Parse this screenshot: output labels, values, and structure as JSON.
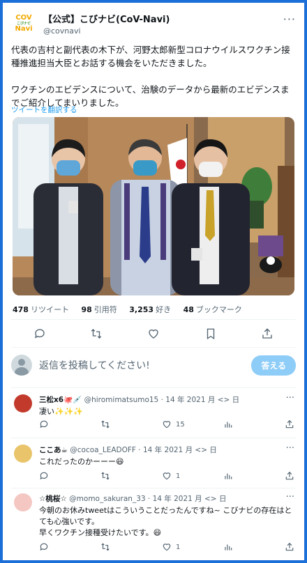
{
  "tweet": {
    "display_name": "【公式】こびナビ(CoV-Navi)",
    "handle": "@covnavi",
    "logo_text": [
      "COV",
      "こびナビ",
      "Navi"
    ],
    "text": "代表の吉村と副代表の木下が、河野太郎新型コロナウイルスワクチン接種推進担当大臣とお話する機会をいただきました。\n\nワクチンのエビデンスについて、治験のデータから最新のエビデンスまでご紹介してまいりました。",
    "translate_label": "ツイートを翻訳する",
    "stats": {
      "retweets": "478",
      "retweets_label": "リツイート",
      "quotes": "98",
      "quotes_label": "引用符",
      "likes": "3,253",
      "likes_label": "好き",
      "bookmarks": "48",
      "bookmarks_label": "ブックマーク"
    }
  },
  "reply_box": {
    "placeholder": "返信を投稿してください!",
    "button": "答える"
  },
  "replies": [
    {
      "name": "三松x6",
      "emoji": "🐙💉",
      "handle": "@hiromimatsumo15",
      "date": "· 14 年 2021 月 <> 日",
      "text": "凄い✨✨✨",
      "reply_count": "",
      "retweet_count": "",
      "like_count": "15",
      "avatar_color": "#c23a2b"
    },
    {
      "name": "ここあ☕",
      "emoji": "",
      "handle": "@cocoa_LEADOFF",
      "date": "· 14 年 2021 月 <> 日",
      "text": "これだったのかーーー😄",
      "reply_count": "",
      "retweet_count": "",
      "like_count": "1",
      "avatar_color": "#e9c46a"
    },
    {
      "name": "☆桃桜☆",
      "emoji": "",
      "handle": "@momo_sakuran_33",
      "date": "· 14 年 2021 月 <> 日",
      "text": "今朝のお休みtweetはこういうことだったんですね~ こびナビの存在はとても心強いです。\n早くワクチン接種受けたいです。😄",
      "reply_count": "",
      "retweet_count": "",
      "like_count": "1",
      "avatar_color": "#f4c7c3"
    }
  ],
  "icons": [
    "reply-icon",
    "retweet-icon",
    "like-icon",
    "bookmark-icon",
    "share-icon",
    "views-icon",
    "more-icon"
  ],
  "colors": {
    "accent": "#1d9bf0",
    "frame": "#1d6fd8",
    "button_disabled": "#8ecdf8"
  }
}
